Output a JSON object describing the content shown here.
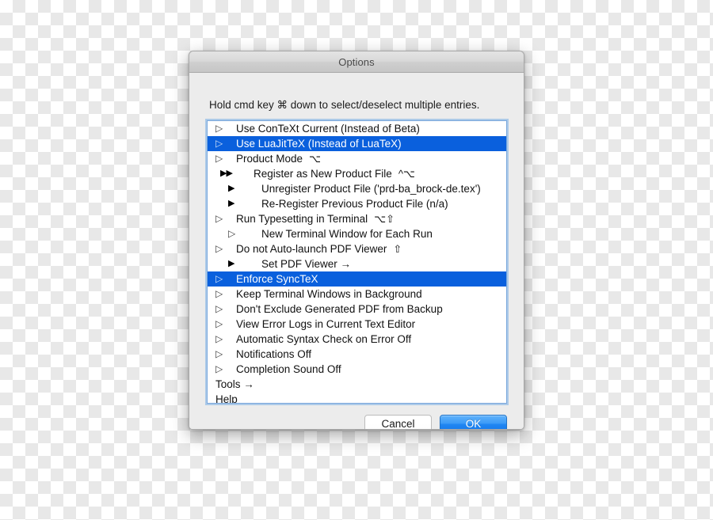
{
  "window": {
    "title": "Options"
  },
  "instruction": "Hold cmd key ⌘ down to select/deselect multiple entries.",
  "options": [
    {
      "marker": "▷",
      "marker_type": "hollow",
      "level": 0,
      "label": "Use ConTeXt Current (Instead of  Beta)",
      "shortcut": "",
      "selected": false
    },
    {
      "marker": "▷",
      "marker_type": "hollow",
      "level": 0,
      "label": "Use LuaJitTeX (Instead of LuaTeX)",
      "shortcut": "",
      "selected": true
    },
    {
      "marker": "▷",
      "marker_type": "hollow",
      "level": 0,
      "label": "Product Mode",
      "shortcut": "⌥",
      "selected": false
    },
    {
      "marker": "▶▶",
      "marker_type": "filled-double",
      "level": 1,
      "label": "Register as New Product File",
      "shortcut": "^⌥",
      "selected": false
    },
    {
      "marker": "▶",
      "marker_type": "filled",
      "level": 1,
      "label": "Unregister Product File ('prd-ba_brock-de.tex')",
      "shortcut": "",
      "selected": false
    },
    {
      "marker": "▶",
      "marker_type": "filled",
      "level": 1,
      "label": "Re-Register Previous Product File (n/a)",
      "shortcut": "",
      "selected": false
    },
    {
      "marker": "▷",
      "marker_type": "hollow",
      "level": 0,
      "label": "Run Typesetting in Terminal",
      "shortcut": "⌥⇧",
      "selected": false
    },
    {
      "marker": "▷",
      "marker_type": "hollow",
      "level": 1,
      "label": "New Terminal Window for Each Run",
      "shortcut": "",
      "selected": false
    },
    {
      "marker": "▷",
      "marker_type": "hollow",
      "level": 0,
      "label": "Do not Auto-launch PDF Viewer",
      "shortcut": "⇧",
      "selected": false
    },
    {
      "marker": "▶",
      "marker_type": "filled",
      "level": 1,
      "label": "Set PDF Viewer →",
      "shortcut": "",
      "selected": false
    },
    {
      "marker": "▷",
      "marker_type": "hollow",
      "level": 0,
      "label": "Enforce SyncTeX",
      "shortcut": "",
      "selected": true
    },
    {
      "marker": "▷",
      "marker_type": "hollow",
      "level": 0,
      "label": "Keep Terminal Windows in Background",
      "shortcut": "",
      "selected": false
    },
    {
      "marker": "▷",
      "marker_type": "hollow",
      "level": 0,
      "label": "Don't Exclude Generated PDF from Backup",
      "shortcut": "",
      "selected": false
    },
    {
      "marker": "▷",
      "marker_type": "hollow",
      "level": 0,
      "label": "View Error Logs in Current Text Editor",
      "shortcut": "",
      "selected": false
    },
    {
      "marker": "▷",
      "marker_type": "hollow",
      "level": 0,
      "label": "Automatic Syntax Check on Error Off",
      "shortcut": "",
      "selected": false
    },
    {
      "marker": "▷",
      "marker_type": "hollow",
      "level": 0,
      "label": "Notifications Off",
      "shortcut": "",
      "selected": false
    },
    {
      "marker": "▷",
      "marker_type": "hollow",
      "level": 0,
      "label": "Completion Sound Off",
      "shortcut": "",
      "selected": false
    },
    {
      "marker": "",
      "marker_type": "none",
      "level": -1,
      "label": "Tools →",
      "shortcut": "",
      "selected": false
    },
    {
      "marker": "",
      "marker_type": "none",
      "level": -1,
      "label": "Help",
      "shortcut": "",
      "selected": false
    }
  ],
  "buttons": {
    "cancel_label": "Cancel",
    "ok_label": "OK"
  },
  "colors": {
    "selection_blue": "#0a60dd",
    "ok_button_blue": "#2086f2",
    "focus_ring": "#7aa8dd",
    "window_background": "#ececec"
  }
}
